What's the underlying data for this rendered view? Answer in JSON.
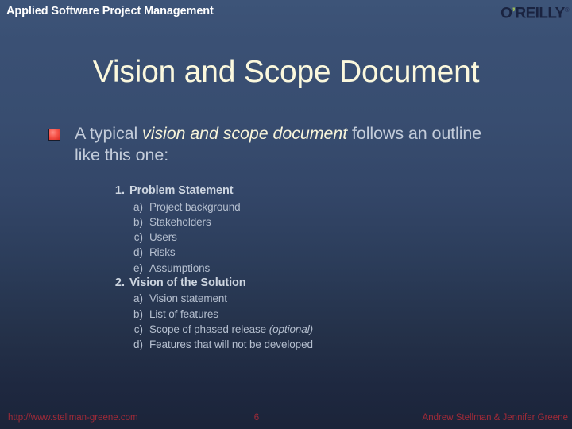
{
  "header": {
    "course_title": "Applied Software Project Management",
    "logo": {
      "pre": "O",
      "apostrophe": "’",
      "post": "REILLY",
      "trademark": "®"
    }
  },
  "slide": {
    "title": "Vision and Scope Document",
    "bullet": {
      "marker": "red-square-bullet",
      "text_before": "A typical ",
      "emphasis": "vision and scope document",
      "text_after": " follows an outline like this one:"
    },
    "outline": [
      {
        "number": "1.",
        "heading": "Problem Statement",
        "subitems": [
          {
            "label": "a)",
            "text": "Project background"
          },
          {
            "label": "b)",
            "text": "Stakeholders"
          },
          {
            "label": "c)",
            "text": "Users"
          },
          {
            "label": "d)",
            "text": "Risks"
          },
          {
            "label": "e)",
            "text": "Assumptions"
          }
        ]
      },
      {
        "number": "2.",
        "heading": "Vision of the Solution",
        "subitems": [
          {
            "label": "a)",
            "text": "Vision statement"
          },
          {
            "label": "b)",
            "text": "List of features"
          },
          {
            "label": "c)",
            "text": "Scope of phased release ",
            "italic_suffix": "(optional)"
          },
          {
            "label": "d)",
            "text": "Features that will not be developed"
          }
        ]
      }
    ]
  },
  "footer": {
    "url": "http://www.stellman-greene.com",
    "page_number": "6",
    "authors": "Andrew Stellman & Jennifer Greene"
  },
  "colors": {
    "background_top": "#3d5478",
    "background_bottom": "#1b2439",
    "title_text": "#fbf8dd",
    "body_text": "#c3ccda",
    "emphasis_text": "#f7f4da",
    "outline_heading": "#cdd5e0",
    "outline_subitem": "#b5bfcf",
    "footer_text": "#a02a38",
    "bullet_red": "#f7564c",
    "logo_navy": "#1a2340",
    "logo_green": "#9fbf5a"
  }
}
